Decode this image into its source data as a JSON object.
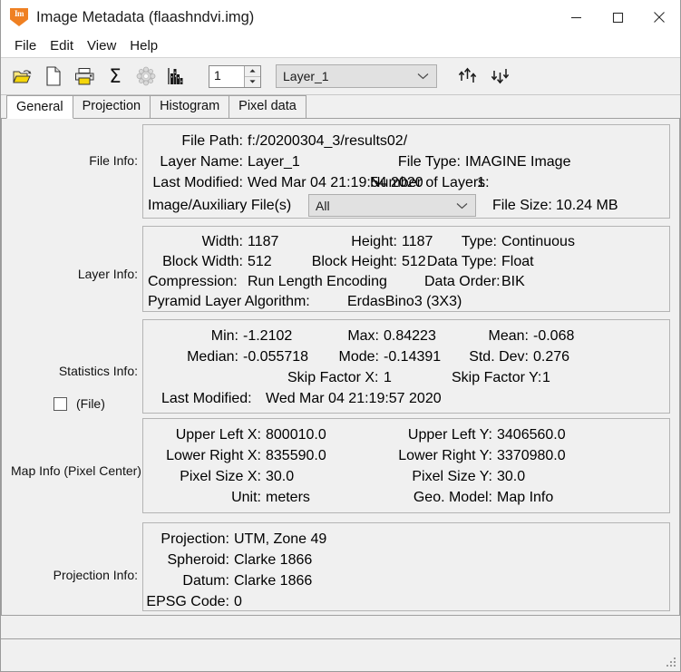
{
  "window": {
    "title": "Image Metadata (flaashndvi.img)",
    "icon": "imagine-app-icon",
    "icon_glyph": "Im",
    "accent": "#ef8022",
    "controls": {
      "minimize": "minimize-button",
      "maximize": "maximize-button",
      "close": "close-button"
    }
  },
  "menubar": {
    "items": [
      {
        "label": "File"
      },
      {
        "label": "Edit"
      },
      {
        "label": "View"
      },
      {
        "label": "Help"
      }
    ]
  },
  "toolbar": {
    "icons": [
      {
        "name": "open-folder-icon"
      },
      {
        "name": "new-file-icon"
      },
      {
        "name": "print-icon"
      },
      {
        "name": "sigma-statistics-icon",
        "glyph": "Σ"
      },
      {
        "name": "pyramid-layer-icon"
      },
      {
        "name": "histogram-icon"
      }
    ],
    "layer_spinner": {
      "value": "1"
    },
    "layer_combo": {
      "selected": "Layer_1"
    },
    "move_up_icon": "move-layer-up-icon",
    "move_down_icon": "move-layer-down-icon"
  },
  "tabs": [
    {
      "label": "General",
      "active": true
    },
    {
      "label": "Projection",
      "active": false
    },
    {
      "label": "Histogram",
      "active": false
    },
    {
      "label": "Pixel data",
      "active": false
    }
  ],
  "sections": {
    "file_info": {
      "label": "File Info:",
      "file_path": {
        "label": "File Path:",
        "value": "f:/20200304_3/results02/"
      },
      "layer_name": {
        "label": "Layer Name:",
        "value": "Layer_1"
      },
      "last_modified": {
        "label": "Last Modified:",
        "value": "Wed Mar 04 21:19:54 2020"
      },
      "file_type": {
        "label": "File Type:",
        "value": "IMAGINE Image"
      },
      "number_of_layers": {
        "label": "Number of Layers:",
        "value": "1"
      },
      "aux_files": {
        "label": "Image/Auxiliary File(s)",
        "selected": "All"
      },
      "file_size": {
        "label": "File Size:",
        "value": "10.24 MB"
      }
    },
    "layer_info": {
      "label": "Layer Info:",
      "width": {
        "label": "Width:",
        "value": "1187"
      },
      "height": {
        "label": "Height:",
        "value": "1187"
      },
      "type": {
        "label": "Type:",
        "value": "Continuous"
      },
      "block_width": {
        "label": "Block Width:",
        "value": "512"
      },
      "block_height": {
        "label": "Block Height:",
        "value": "512"
      },
      "data_type": {
        "label": "Data Type:",
        "value": "Float"
      },
      "compression": {
        "label": "Compression:",
        "value": "Run Length Encoding"
      },
      "data_order": {
        "label": "Data Order:",
        "value": "BIK"
      },
      "pyramid": {
        "label": "Pyramid Layer Algorithm:",
        "value": "ErdasBino3 (3X3)"
      }
    },
    "statistics_info": {
      "label": "Statistics Info:",
      "min": {
        "label": "Min:",
        "value": "-1.2102"
      },
      "max": {
        "label": "Max:",
        "value": "0.84223"
      },
      "mean": {
        "label": "Mean:",
        "value": "-0.068"
      },
      "median": {
        "label": "Median:",
        "value": "-0.055718"
      },
      "mode": {
        "label": "Mode:",
        "value": "-0.14391"
      },
      "std_dev": {
        "label": "Std. Dev:",
        "value": "0.276"
      },
      "skip_x": {
        "label": "Skip Factor X:",
        "value": "1"
      },
      "skip_y": {
        "label": "Skip Factor Y:",
        "value": "1"
      },
      "last_modified": {
        "label": "Last Modified:",
        "value": "Wed Mar 04 21:19:57 2020"
      },
      "file_checkbox": {
        "label": "(File)",
        "checked": false
      }
    },
    "map_info": {
      "label": "Map Info (Pixel Center):",
      "upper_left_x": {
        "label": "Upper Left X:",
        "value": "800010.0"
      },
      "upper_left_y": {
        "label": "Upper Left Y:",
        "value": "3406560.0"
      },
      "lower_right_x": {
        "label": "Lower Right X:",
        "value": "835590.0"
      },
      "lower_right_y": {
        "label": "Lower Right Y:",
        "value": "3370980.0"
      },
      "pixel_size_x": {
        "label": "Pixel Size X:",
        "value": "30.0"
      },
      "pixel_size_y": {
        "label": "Pixel Size Y:",
        "value": "30.0"
      },
      "unit": {
        "label": "Unit:",
        "value": "meters"
      },
      "geo_model": {
        "label": "Geo. Model:",
        "value": "Map Info"
      }
    },
    "projection_info": {
      "label": "Projection Info:",
      "projection": {
        "label": "Projection:",
        "value": "UTM, Zone 49"
      },
      "spheroid": {
        "label": "Spheroid:",
        "value": "Clarke 1866"
      },
      "datum": {
        "label": "Datum:",
        "value": "Clarke 1866"
      },
      "epsg": {
        "label": "EPSG Code:",
        "value": "0"
      }
    }
  }
}
